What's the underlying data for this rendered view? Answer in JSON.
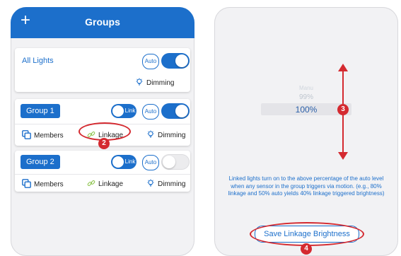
{
  "left_screen": {
    "header": {
      "plus_icon": "plus-icon",
      "title": "Groups"
    },
    "all_lights": {
      "label": "All Lights",
      "auto_label": "Auto",
      "power_on": true,
      "dimming_label": "Dimming"
    },
    "groups": [
      {
        "name": "Group 1",
        "link_label": "Link",
        "link_on": true,
        "auto_label": "Auto",
        "power_on": true,
        "members_label": "Members",
        "linkage_label": "Linkage",
        "dimming_label": "Dimming"
      },
      {
        "name": "Group 2",
        "link_label": "Link",
        "link_on": true,
        "auto_label": "Auto",
        "power_on": false,
        "members_label": "Members",
        "linkage_label": "Linkage",
        "dimming_label": "Dimming"
      }
    ]
  },
  "right_screen": {
    "picker": {
      "items": [
        "Manu",
        "99%",
        "100%"
      ],
      "selected": "100%"
    },
    "description": "Linked lights turn on to the above percentage of the auto level when any sensor in the group triggers via motion. (e.g., 80% linkage and 50% auto yields 40% linkage triggered brightness)",
    "save_button": "Save Linkage Brightness"
  },
  "callouts": [
    "2",
    "3",
    "4"
  ],
  "colors": {
    "primary": "#1c6fcb",
    "annotation": "#d42a30",
    "background": "#f2f2f4"
  }
}
